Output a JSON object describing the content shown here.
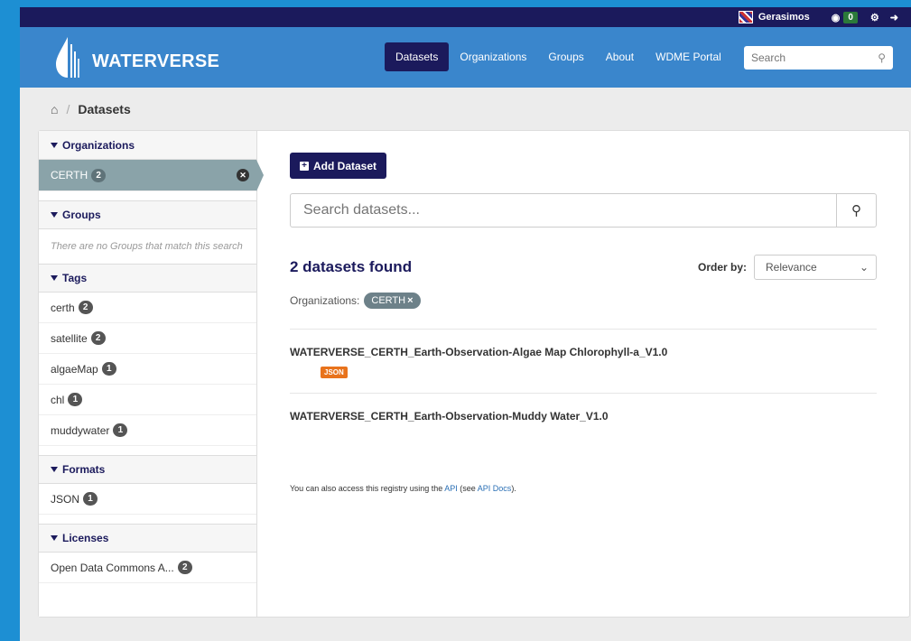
{
  "account": {
    "user": "Gerasimos",
    "dashboard_count": "0"
  },
  "header": {
    "logo_text": "WATERVERSE",
    "nav": [
      "Datasets",
      "Organizations",
      "Groups",
      "About",
      "WDME Portal"
    ],
    "search_placeholder": "Search"
  },
  "breadcrumb": {
    "current": "Datasets"
  },
  "sidebar": {
    "organizations": {
      "title": "Organizations",
      "items": [
        {
          "label": "CERTH",
          "count": "2"
        }
      ]
    },
    "groups": {
      "title": "Groups",
      "empty": "There are no Groups that match this search"
    },
    "tags": {
      "title": "Tags",
      "items": [
        {
          "label": "certh",
          "count": "2"
        },
        {
          "label": "satellite",
          "count": "2"
        },
        {
          "label": "algaeMap",
          "count": "1"
        },
        {
          "label": "chl",
          "count": "1"
        },
        {
          "label": "muddywater",
          "count": "1"
        }
      ]
    },
    "formats": {
      "title": "Formats",
      "items": [
        {
          "label": "JSON",
          "count": "1"
        }
      ]
    },
    "licenses": {
      "title": "Licenses",
      "items": [
        {
          "label": "Open Data Commons A...",
          "count": "2"
        }
      ]
    }
  },
  "main": {
    "add_button": "Add Dataset",
    "search_placeholder": "Search datasets...",
    "results_count": "2 datasets found",
    "order_label": "Order by:",
    "order_value": "Relevance",
    "filter_label": "Organizations:",
    "filter_pill": "CERTH",
    "datasets": [
      {
        "title": "WATERVERSE_CERTH_Earth-Observation-Algae Map Chlorophyll-a_V1.0",
        "format": "JSON"
      },
      {
        "title": "WATERVERSE_CERTH_Earth-Observation-Muddy Water_V1.0"
      }
    ],
    "api_note": {
      "prefix": "You can also access this registry using the ",
      "api_link": "API",
      "middle": " (see ",
      "docs_link": "API Docs",
      "suffix": ")."
    }
  }
}
